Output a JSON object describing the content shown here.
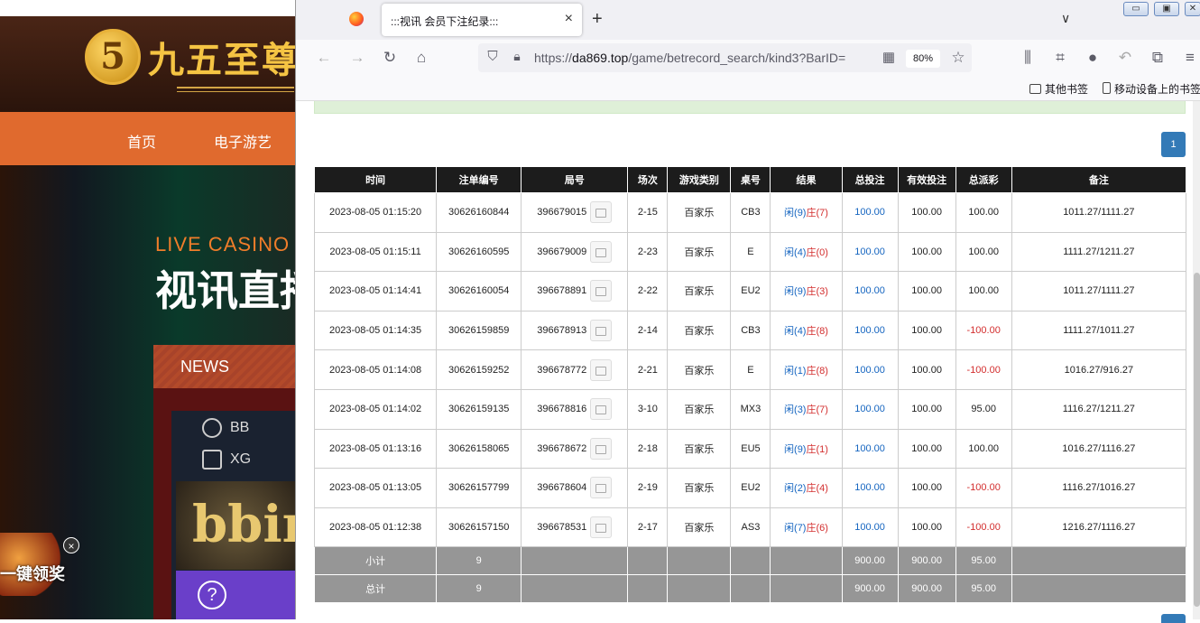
{
  "background_site": {
    "logo_mark": "5",
    "logo_text": "九五至尊",
    "nav": [
      "首页",
      "电子游艺"
    ],
    "live_casino": "LIVE CASINO",
    "hero_title": "视讯直播",
    "news": "NEWS",
    "games": [
      "BB",
      "XG"
    ],
    "bbin_logo": "bbin",
    "help": "?",
    "promo_text": "一键领奖",
    "promo_close": "×"
  },
  "browser": {
    "tab_title": ":::视讯 会员下注纪录:::",
    "tab_close": "×",
    "new_tab": "+",
    "tabs_menu": "∨",
    "window_buttons": [
      "▭",
      "▣",
      "✕"
    ],
    "url_domain": "da869.top",
    "url_prefix": "https://",
    "url_path": "/game/betrecord_search/kind3?BarID=",
    "zoom": "80%",
    "bookmarks": [
      "其他书签",
      "移动设备上的书签"
    ]
  },
  "page": {
    "pagination": "1",
    "table": {
      "headers": [
        "时间",
        "注单编号",
        "局号",
        "场次",
        "游戏类别",
        "桌号",
        "结果",
        "总投注",
        "有效投注",
        "总派彩",
        "备注"
      ],
      "rows": [
        {
          "time": "2023-08-05 01:15:20",
          "order": "30626160844",
          "round": "396679015",
          "session": "2-15",
          "game": "百家乐",
          "table": "CB3",
          "xian": "闲(9)",
          "zhuang": "庄(7)",
          "bet": "100.00",
          "valid": "100.00",
          "payout": "100.00",
          "note": "1011.27/1111.27"
        },
        {
          "time": "2023-08-05 01:15:11",
          "order": "30626160595",
          "round": "396679009",
          "session": "2-23",
          "game": "百家乐",
          "table": "E",
          "xian": "闲(4)",
          "zhuang": "庄(0)",
          "bet": "100.00",
          "valid": "100.00",
          "payout": "100.00",
          "note": "1111.27/1211.27"
        },
        {
          "time": "2023-08-05 01:14:41",
          "order": "30626160054",
          "round": "396678891",
          "session": "2-22",
          "game": "百家乐",
          "table": "EU2",
          "xian": "闲(9)",
          "zhuang": "庄(3)",
          "bet": "100.00",
          "valid": "100.00",
          "payout": "100.00",
          "note": "1011.27/1111.27"
        },
        {
          "time": "2023-08-05 01:14:35",
          "order": "30626159859",
          "round": "396678913",
          "session": "2-14",
          "game": "百家乐",
          "table": "CB3",
          "xian": "闲(4)",
          "zhuang": "庄(8)",
          "bet": "100.00",
          "valid": "100.00",
          "payout": "-100.00",
          "note": "1111.27/1011.27"
        },
        {
          "time": "2023-08-05 01:14:08",
          "order": "30626159252",
          "round": "396678772",
          "session": "2-21",
          "game": "百家乐",
          "table": "E",
          "xian": "闲(1)",
          "zhuang": "庄(8)",
          "bet": "100.00",
          "valid": "100.00",
          "payout": "-100.00",
          "note": "1016.27/916.27"
        },
        {
          "time": "2023-08-05 01:14:02",
          "order": "30626159135",
          "round": "396678816",
          "session": "3-10",
          "game": "百家乐",
          "table": "MX3",
          "xian": "闲(3)",
          "zhuang": "庄(7)",
          "bet": "100.00",
          "valid": "100.00",
          "payout": "95.00",
          "note": "1116.27/1211.27"
        },
        {
          "time": "2023-08-05 01:13:16",
          "order": "30626158065",
          "round": "396678672",
          "session": "2-18",
          "game": "百家乐",
          "table": "EU5",
          "xian": "闲(9)",
          "zhuang": "庄(1)",
          "bet": "100.00",
          "valid": "100.00",
          "payout": "100.00",
          "note": "1016.27/1116.27"
        },
        {
          "time": "2023-08-05 01:13:05",
          "order": "30626157799",
          "round": "396678604",
          "session": "2-19",
          "game": "百家乐",
          "table": "EU2",
          "xian": "闲(2)",
          "zhuang": "庄(4)",
          "bet": "100.00",
          "valid": "100.00",
          "payout": "-100.00",
          "note": "1116.27/1016.27"
        },
        {
          "time": "2023-08-05 01:12:38",
          "order": "30626157150",
          "round": "396678531",
          "session": "2-17",
          "game": "百家乐",
          "table": "AS3",
          "xian": "闲(7)",
          "zhuang": "庄(6)",
          "bet": "100.00",
          "valid": "100.00",
          "payout": "-100.00",
          "note": "1216.27/1116.27"
        }
      ],
      "subtotal": {
        "label": "小计",
        "count": "9",
        "bet": "900.00",
        "valid": "900.00",
        "payout": "95.00"
      },
      "total": {
        "label": "总计",
        "count": "9",
        "bet": "900.00",
        "valid": "900.00",
        "payout": "95.00"
      }
    }
  },
  "colors": {
    "header_bg": "#1c1c1c",
    "bet_blue": "#1565c0",
    "negative_red": "#d32f2f",
    "summary_gray": "#969696",
    "pager_blue": "#337ab7"
  }
}
